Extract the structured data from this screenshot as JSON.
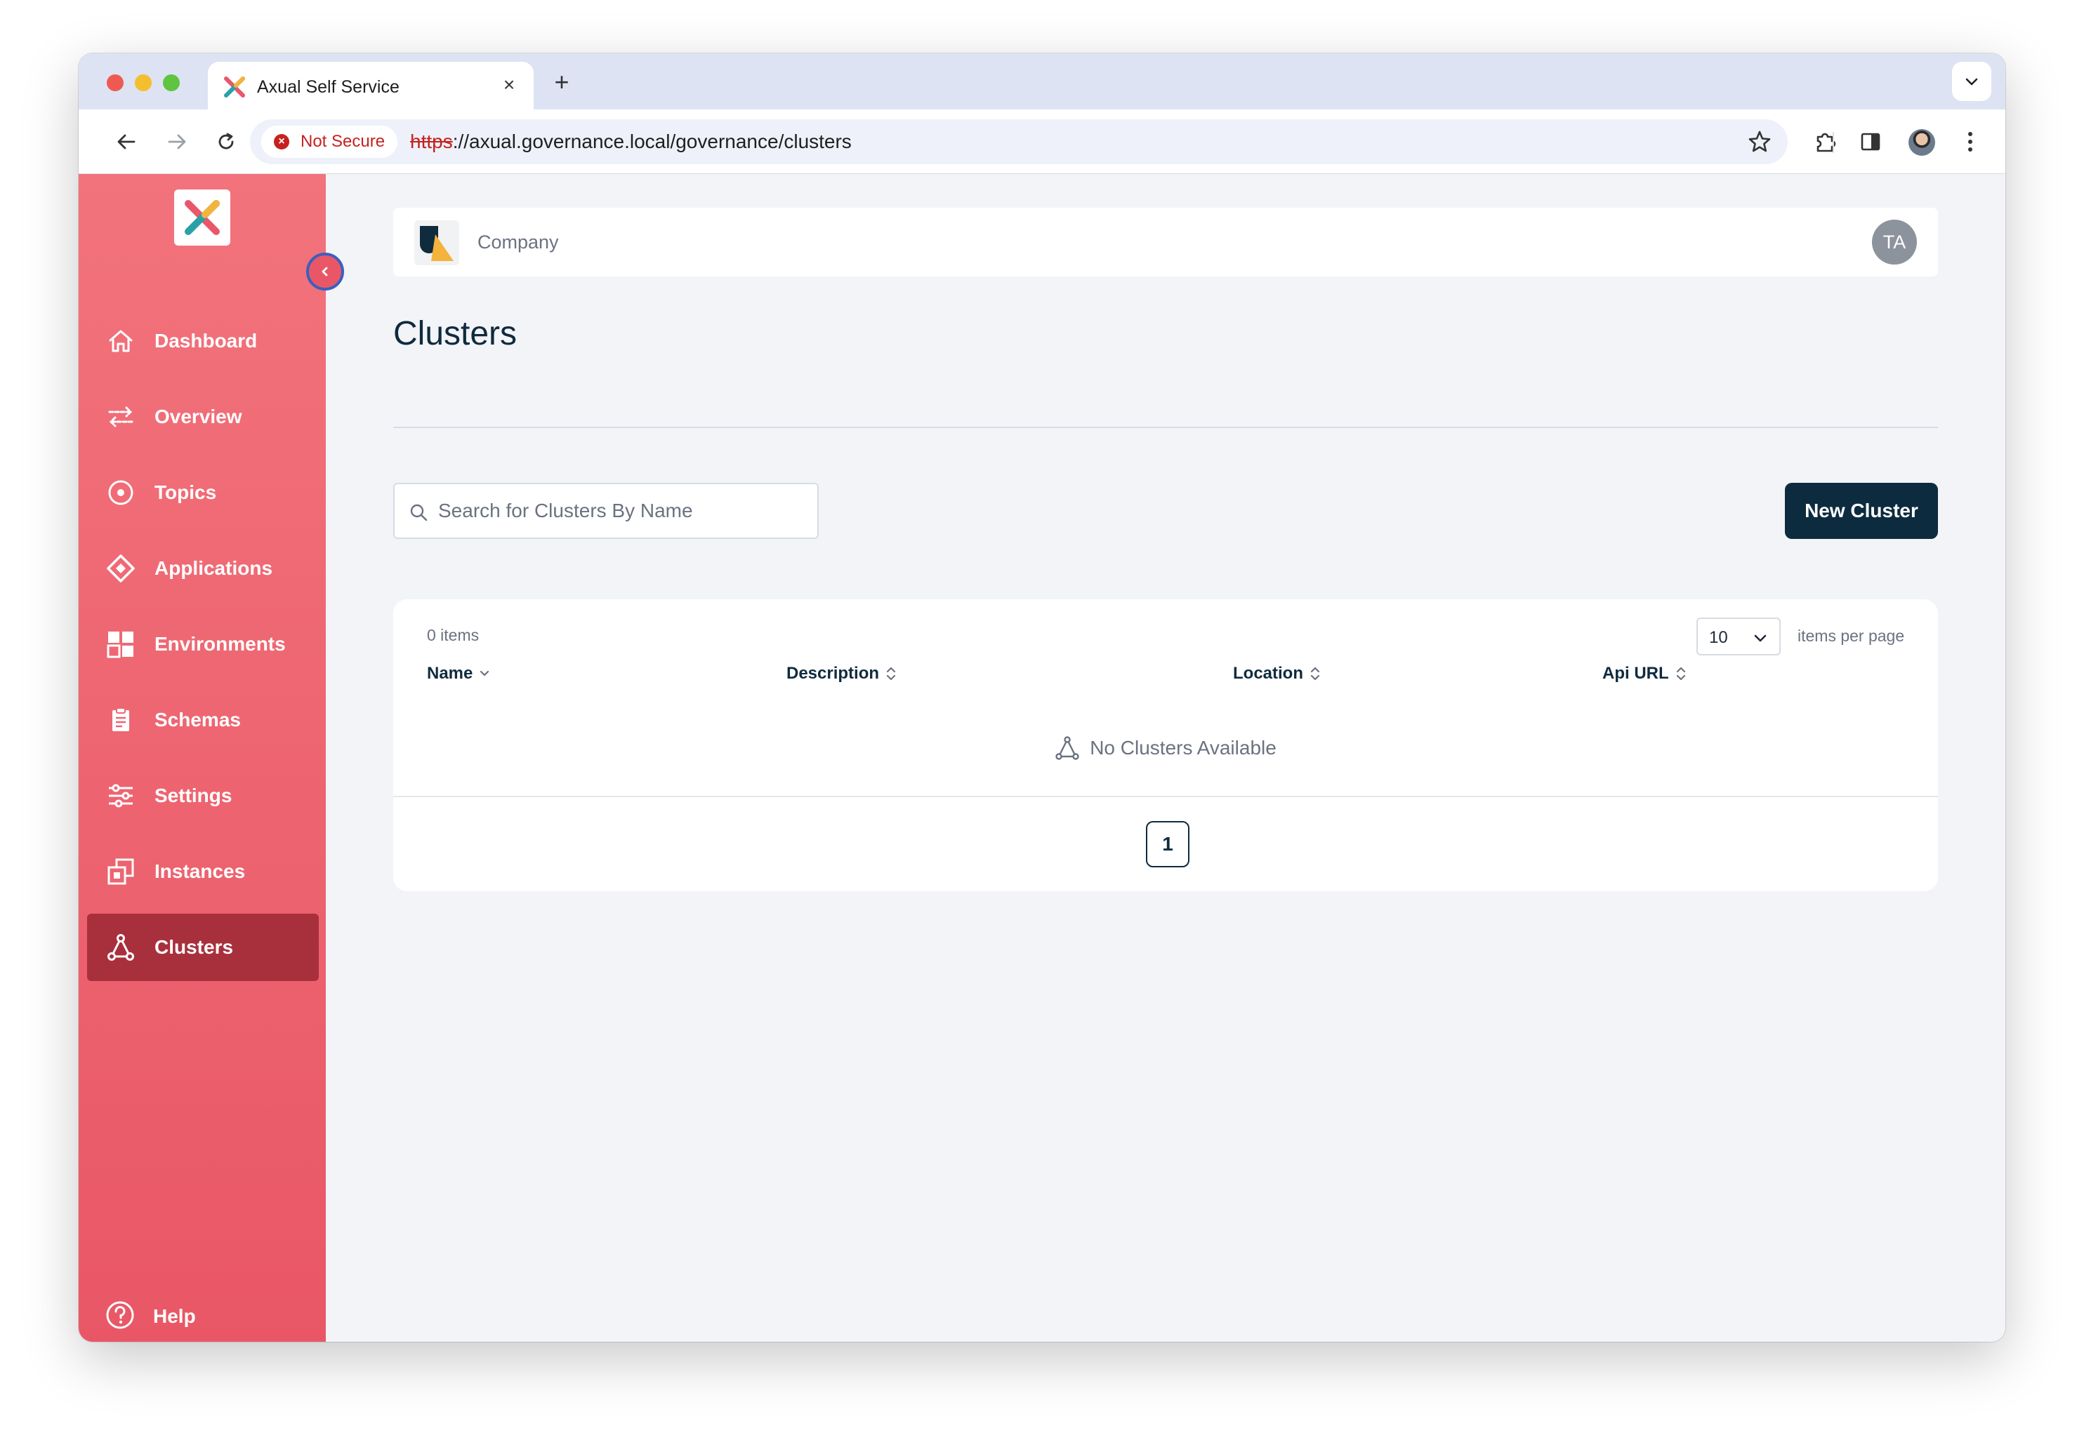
{
  "browser": {
    "tab_title": "Axual Self Service",
    "close_glyph": "×",
    "new_tab_glyph": "+",
    "security_label": "Not Secure",
    "url_scheme": "https",
    "url_rest": "://axual.governance.local/governance/clusters"
  },
  "company": {
    "name": "Company",
    "user_initials": "TA"
  },
  "sidebar": {
    "items": [
      {
        "label": "Dashboard",
        "icon": "home-icon"
      },
      {
        "label": "Overview",
        "icon": "arrows-exchange-icon"
      },
      {
        "label": "Topics",
        "icon": "target-icon"
      },
      {
        "label": "Applications",
        "icon": "diamond-icon"
      },
      {
        "label": "Environments",
        "icon": "grid-icon"
      },
      {
        "label": "Schemas",
        "icon": "clipboard-icon"
      },
      {
        "label": "Settings",
        "icon": "sliders-icon"
      },
      {
        "label": "Instances",
        "icon": "instances-icon"
      },
      {
        "label": "Clusters",
        "icon": "cluster-icon",
        "active": true
      }
    ],
    "help_label": "Help"
  },
  "page": {
    "title": "Clusters",
    "search_placeholder": "Search for Clusters By Name",
    "new_button": "New Cluster"
  },
  "table": {
    "items_count": "0 items",
    "per_page_value": "10",
    "per_page_label": "items per page",
    "columns": [
      "Name",
      "Description",
      "Location",
      "Api URL"
    ],
    "empty_message": "No Clusters Available",
    "current_page": "1"
  },
  "colors": {
    "sidebar_top": "#f2737c",
    "sidebar_bottom": "#e95766",
    "sidebar_active": "#a8303d",
    "primary_dark": "#0d2b3e",
    "not_secure_red": "#c5221f"
  }
}
